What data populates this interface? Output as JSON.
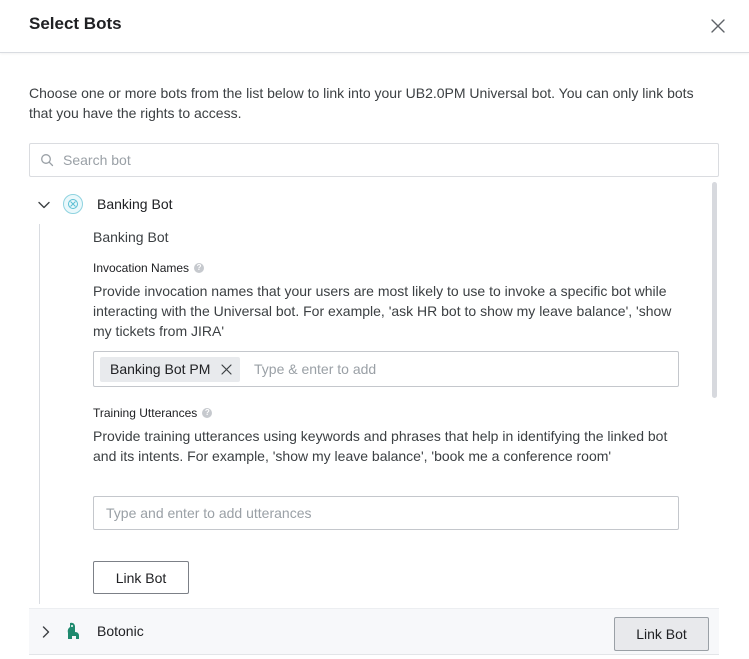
{
  "dialog": {
    "title": "Select Bots",
    "close_icon": "close-icon",
    "description": "Choose one or more bots from the list below to link into your UB2.0PM Universal bot. You can only link bots that you have the rights to access."
  },
  "search": {
    "placeholder": "Search bot",
    "icon": "search-icon"
  },
  "bots": [
    {
      "name": "Banking Bot",
      "expanded": true,
      "subtitle": "Banking Bot",
      "invocation": {
        "label": "Invocation Names",
        "description": "Provide invocation names that your users are most likely to use to invoke a specific bot while interacting with the Universal bot. For example, 'ask HR bot to show my leave balance', 'show my tickets from JIRA'",
        "tags": [
          "Banking Bot PM"
        ],
        "placeholder": "Type & enter to add"
      },
      "utterances": {
        "label": "Training Utterances",
        "description": "Provide training utterances using keywords and phrases that help in identifying the linked bot and its intents. For example, 'show my leave balance', 'book me a conference room'",
        "placeholder": "Type and enter to add utterances"
      },
      "link_button": "Link Bot"
    },
    {
      "name": "Botonic",
      "expanded": false,
      "link_button": "Link Bot"
    }
  ],
  "colors": {
    "border": "#dadce0",
    "chip_bg": "#e8eaed",
    "collapsed_row_bg": "#f7f8fa",
    "avatar_accent": "#8fd3e0",
    "botonic_green": "#1f8a6e"
  }
}
